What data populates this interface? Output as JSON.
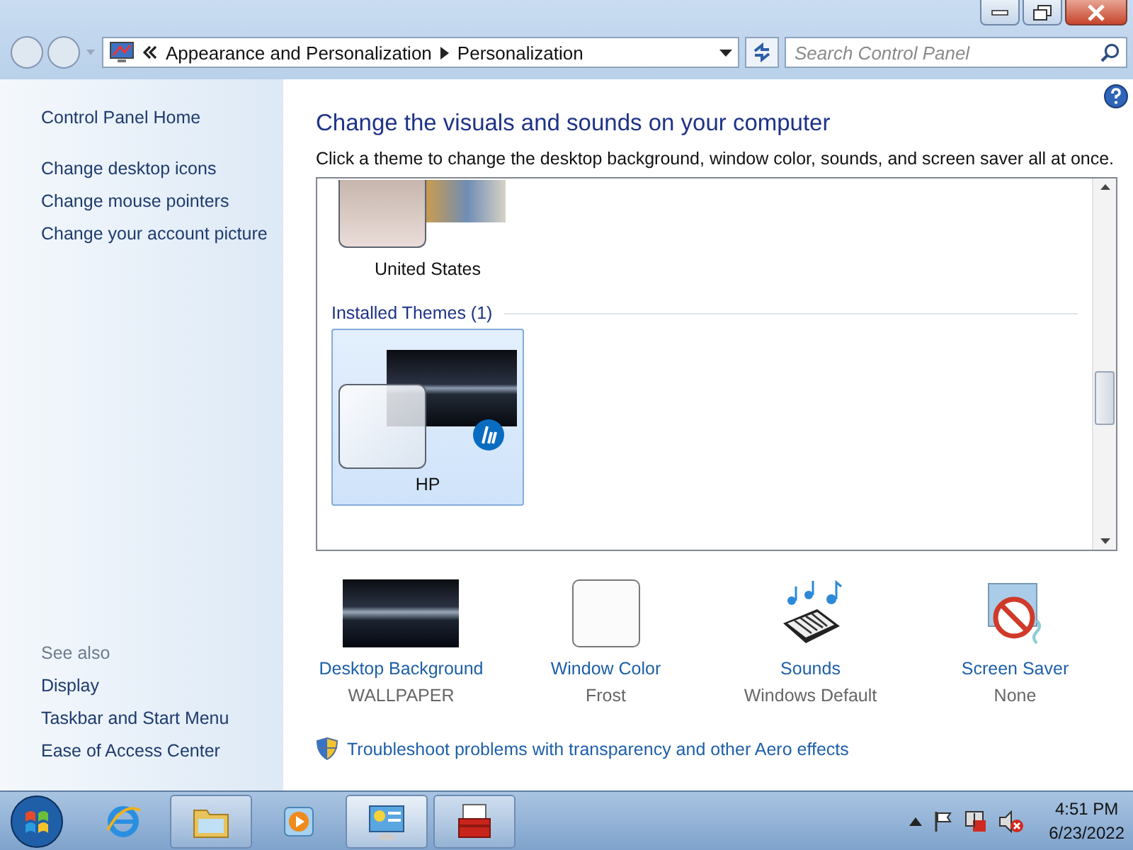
{
  "window": {
    "controls": [
      {
        "kind": "minimize"
      },
      {
        "kind": "maximize"
      },
      {
        "kind": "close"
      }
    ]
  },
  "address_bar": {
    "breadcrumbs": [
      "Appearance and Personalization",
      "Personalization"
    ]
  },
  "search": {
    "placeholder": "Search Control Panel"
  },
  "sidebar": {
    "links": [
      "Control Panel Home",
      "Change desktop icons",
      "Change mouse pointers",
      "Change your account picture"
    ],
    "see_also": {
      "heading": "See also",
      "links": [
        "Display",
        "Taskbar and Start Menu",
        "Ease of Access Center"
      ]
    }
  },
  "content": {
    "title": "Change the visuals and sounds on your computer",
    "subtitle": "Click a theme to change the desktop background, window color, sounds, and screen saver all at once.",
    "theme_groups": [
      {
        "items": [
          {
            "name": "United States",
            "kind": "photos",
            "selected": false
          }
        ]
      },
      {
        "heading": "Installed Themes (1)",
        "items": [
          {
            "name": "HP",
            "kind": "brand",
            "selected": true
          }
        ]
      }
    ],
    "settings": [
      {
        "kind": "wallpaper",
        "label": "Desktop Background",
        "value": "WALLPAPER"
      },
      {
        "kind": "color",
        "label": "Window Color",
        "value": "Frost"
      },
      {
        "kind": "sounds",
        "label": "Sounds",
        "value": "Windows Default"
      },
      {
        "kind": "screensaver",
        "label": "Screen Saver",
        "value": "None"
      }
    ],
    "troubleshoot_link": "Troubleshoot problems with transparency and other Aero effects"
  },
  "taskbar": {
    "apps": [
      {
        "kind": "browser",
        "running": false,
        "selected": false
      },
      {
        "kind": "folder",
        "running": true,
        "selected": false
      },
      {
        "kind": "media",
        "running": false,
        "selected": false
      },
      {
        "kind": "control-panel",
        "running": true,
        "selected": true
      },
      {
        "kind": "toolbox",
        "running": true,
        "selected": false
      }
    ],
    "clock": {
      "time": "4:51 PM",
      "date": "6/23/2022"
    }
  }
}
